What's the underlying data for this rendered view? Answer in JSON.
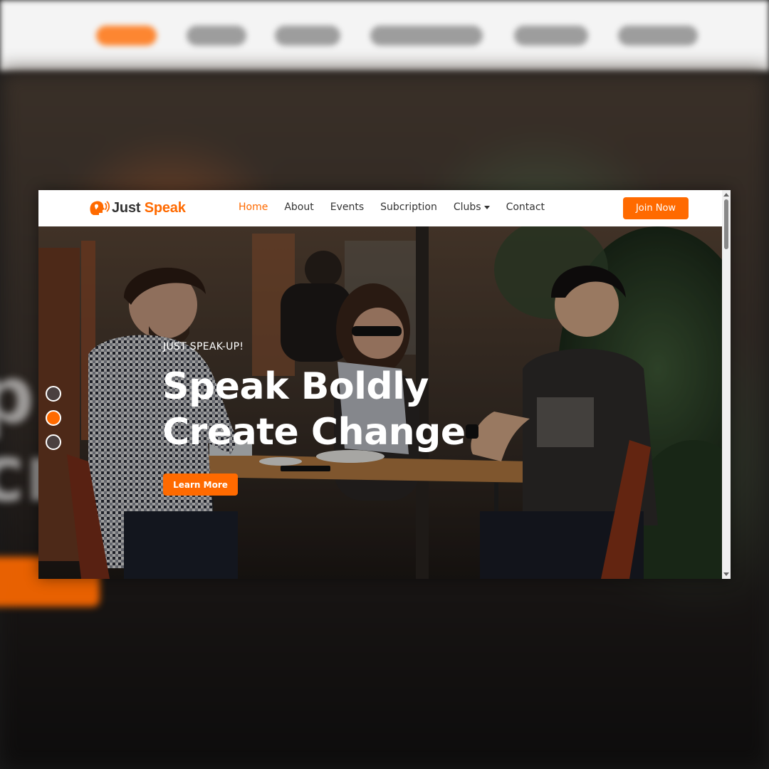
{
  "backdrop": {
    "text": "p\ncr"
  },
  "navbar": {
    "logo": {
      "word1": "Just",
      "word2": "Speak",
      "icon": "speaking-head-logo-icon"
    },
    "links": [
      {
        "label": "Home",
        "active": true
      },
      {
        "label": "About",
        "active": false
      },
      {
        "label": "Events",
        "active": false
      },
      {
        "label": "Subcription",
        "active": false
      },
      {
        "label": "Clubs",
        "active": false,
        "dropdown": true
      },
      {
        "label": "Contact",
        "active": false
      }
    ],
    "join_label": "Join Now"
  },
  "hero": {
    "eyebrow": "JUST SPEAK-UP!",
    "headline_line1": "Speak Boldly",
    "headline_line2": "Create Change",
    "cta_label": "Learn More",
    "slides": 3,
    "active_slide": 2
  },
  "colors": {
    "accent": "#ff6a00",
    "nav_text": "#333333",
    "white": "#ffffff"
  }
}
